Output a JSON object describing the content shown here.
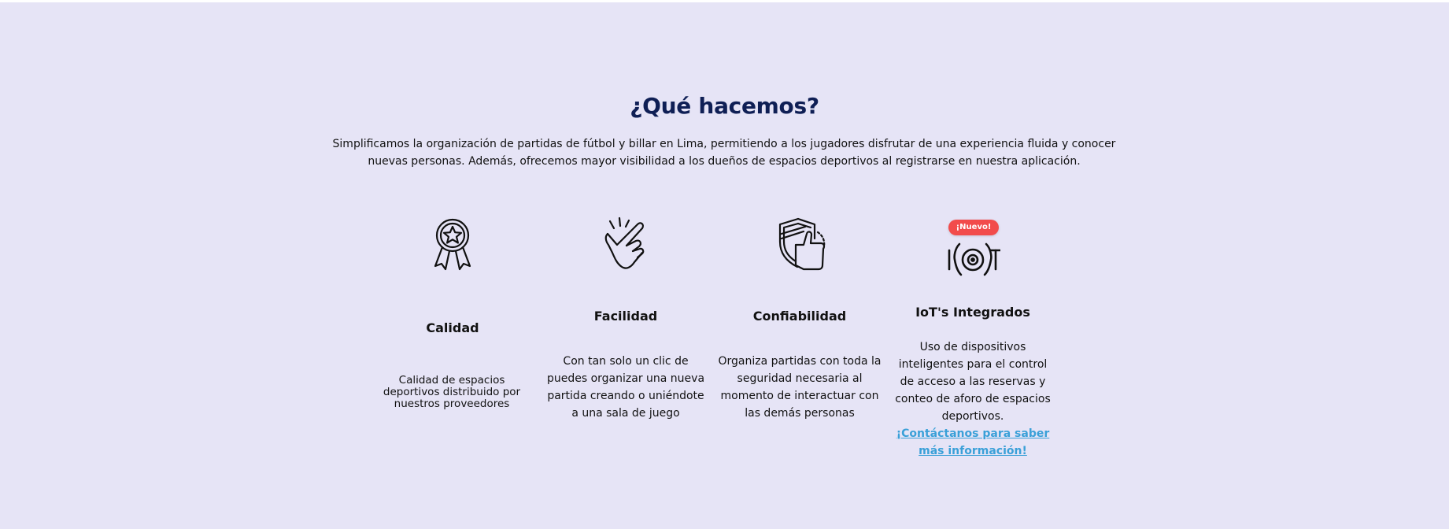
{
  "colors": {
    "section_background": "#e6e4f6",
    "title": "#0f1f55",
    "badge": "#f24b4b",
    "link": "#3aa0d8"
  },
  "section": {
    "title": "¿Qué hacemos?",
    "intro": "Simplificamos la organización de partidas de fútbol y billar en Lima, permitiendo a los jugadores disfrutar de una experiencia fluida y conocer nuevas personas. Además, ofrecemos mayor visibilidad a los dueños de espacios deportivos al registrarse en nuestra aplicación."
  },
  "features": [
    {
      "icon": "award-ribbon-icon",
      "title": "Calidad",
      "description": "Calidad de espacios deportivos distribuido por nuestros proveedores"
    },
    {
      "icon": "finger-snap-icon",
      "title": "Facilidad",
      "description": "Con tan solo un clic de puedes organizar una nueva partida creando o uniéndote a una sala de juego"
    },
    {
      "icon": "shield-thumbs-up-icon",
      "title": "Confiabilidad",
      "description": "Organiza partidas con toda la seguridad necesaria al momento de interactuar con las demás personas"
    },
    {
      "icon": "iot-icon",
      "title": "IoT's Integrados",
      "badge": "¡Nuevo!",
      "description": "Uso de dispositivos inteligentes para el control de acceso a las reservas y conteo de aforo de espacios deportivos.",
      "link": "¡Contáctanos para saber más información!"
    }
  ]
}
